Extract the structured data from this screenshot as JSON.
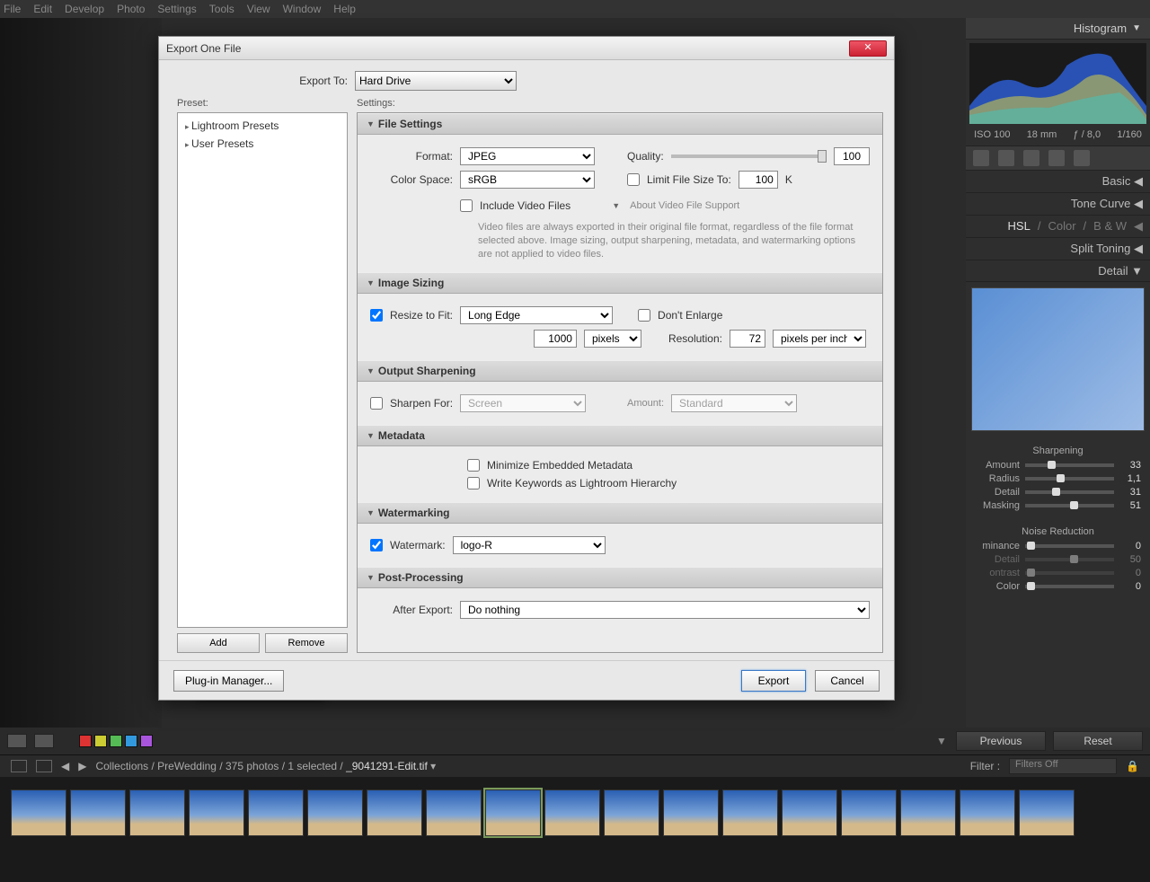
{
  "menubar": [
    "File",
    "Edit",
    "Develop",
    "Photo",
    "Settings",
    "Tools",
    "View",
    "Window",
    "Help"
  ],
  "dialog": {
    "title": "Export One File",
    "export_to_label": "Export To:",
    "export_to_value": "Hard Drive",
    "preset_label": "Preset:",
    "settings_label": "Settings:",
    "presets": [
      "Lightroom Presets",
      "User Presets"
    ],
    "add_btn": "Add",
    "remove_btn": "Remove",
    "plugin_btn": "Plug-in Manager...",
    "export_btn": "Export",
    "cancel_btn": "Cancel",
    "sections": {
      "file_settings": {
        "title": "File Settings",
        "format_label": "Format:",
        "format_value": "JPEG",
        "quality_label": "Quality:",
        "quality_value": "100",
        "colorspace_label": "Color Space:",
        "colorspace_value": "sRGB",
        "limit_label": "Limit File Size To:",
        "limit_value": "100",
        "limit_unit": "K",
        "include_video": "Include Video Files",
        "about_video": "About Video File Support",
        "video_info": "Video files are always exported in their original file format, regardless of the file format selected above. Image sizing, output sharpening, metadata, and watermarking options are not applied to video files."
      },
      "image_sizing": {
        "title": "Image Sizing",
        "resize_label": "Resize to Fit:",
        "resize_value": "Long Edge",
        "dont_enlarge": "Don't Enlarge",
        "size_value": "1000",
        "size_unit": "pixels",
        "resolution_label": "Resolution:",
        "resolution_value": "72",
        "resolution_unit": "pixels per inch"
      },
      "output_sharpening": {
        "title": "Output Sharpening",
        "sharpen_label": "Sharpen For:",
        "sharpen_value": "Screen",
        "amount_label": "Amount:",
        "amount_value": "Standard"
      },
      "metadata": {
        "title": "Metadata",
        "minimize": "Minimize Embedded Metadata",
        "keywords": "Write Keywords as Lightroom Hierarchy"
      },
      "watermarking": {
        "title": "Watermarking",
        "label": "Watermark:",
        "value": "logo-R"
      },
      "postprocessing": {
        "title": "Post-Processing",
        "after_label": "After Export:",
        "after_value": "Do nothing"
      }
    }
  },
  "right_panel": {
    "histogram": "Histogram",
    "histo_meta": [
      "ISO 100",
      "18 mm",
      "ƒ / 8,0",
      "1/160"
    ],
    "basic": "Basic",
    "tone_curve": "Tone Curve",
    "hsl_tabs": [
      "HSL",
      "Color",
      "B & W"
    ],
    "split_toning": "Split Toning",
    "detail": "Detail",
    "sharpening": {
      "title": "Sharpening",
      "rows": [
        {
          "label": "Amount",
          "value": "33",
          "pos": 25
        },
        {
          "label": "Radius",
          "value": "1,1",
          "pos": 35
        },
        {
          "label": "Detail",
          "value": "31",
          "pos": 30
        },
        {
          "label": "Masking",
          "value": "51",
          "pos": 50
        }
      ]
    },
    "noise": {
      "title": "Noise Reduction",
      "rows": [
        {
          "label": "minance",
          "value": "0",
          "pos": 2,
          "dim": false
        },
        {
          "label": "Detail",
          "value": "50",
          "pos": 50,
          "dim": true
        },
        {
          "label": "ontrast",
          "value": "0",
          "pos": 2,
          "dim": true
        },
        {
          "label": "Color",
          "value": "0",
          "pos": 2,
          "dim": false
        }
      ]
    }
  },
  "bottom": {
    "previous": "Previous",
    "reset": "Reset",
    "colors": [
      "#d33",
      "#cc3",
      "#5b5",
      "#39d",
      "#a5d"
    ]
  },
  "strip": {
    "breadcrumb": "Collections / PreWedding / 375 photos / 1 selected / ",
    "filename": "_9041291-Edit.tif",
    "filter_label": "Filter :",
    "filter_value": "Filters Off"
  }
}
